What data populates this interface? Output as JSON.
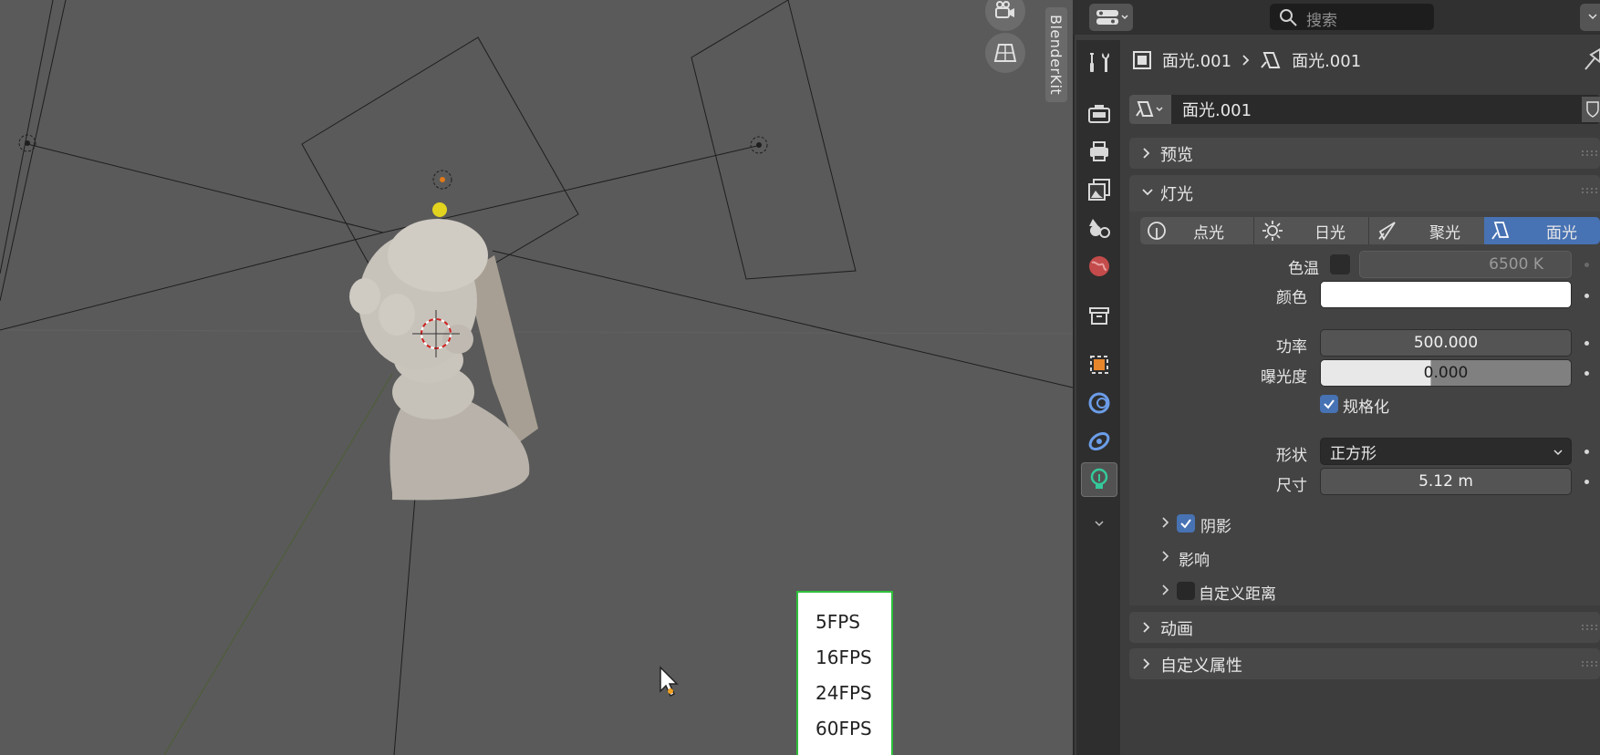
{
  "viewport": {
    "side_tab": "BlenderKit",
    "fps_menu": [
      "5FPS",
      "16FPS",
      "24FPS",
      "60FPS"
    ]
  },
  "header": {
    "search_placeholder": "搜索"
  },
  "breadcrumb": {
    "object": "面光.001",
    "data": "面光.001"
  },
  "datablock_name": "面光.001",
  "panels": {
    "preview": "预览",
    "light": "灯光",
    "animation": "动画",
    "custom_props": "自定义属性"
  },
  "light": {
    "types": [
      "点光",
      "日光",
      "聚光",
      "面光"
    ],
    "active_type": "面光",
    "color_temp_label": "色温",
    "color_temp_value": "6500 K",
    "color_label": "颜色",
    "color_value": "#ffffff",
    "power_label": "功率",
    "power_value": "500.000",
    "exposure_label": "曝光度",
    "exposure_value": "0.000",
    "normalize_label": "规格化",
    "normalize_checked": true,
    "shape_label": "形状",
    "shape_value": "正方形",
    "size_label": "尺寸",
    "size_value": "5.12 m",
    "shadow_label": "阴影",
    "shadow_checked": true,
    "influence_label": "影响",
    "custom_distance_label": "自定义距离",
    "custom_distance_checked": false
  },
  "colors": {
    "accent": "#4772b3",
    "fps_border": "#2fbf3b"
  }
}
